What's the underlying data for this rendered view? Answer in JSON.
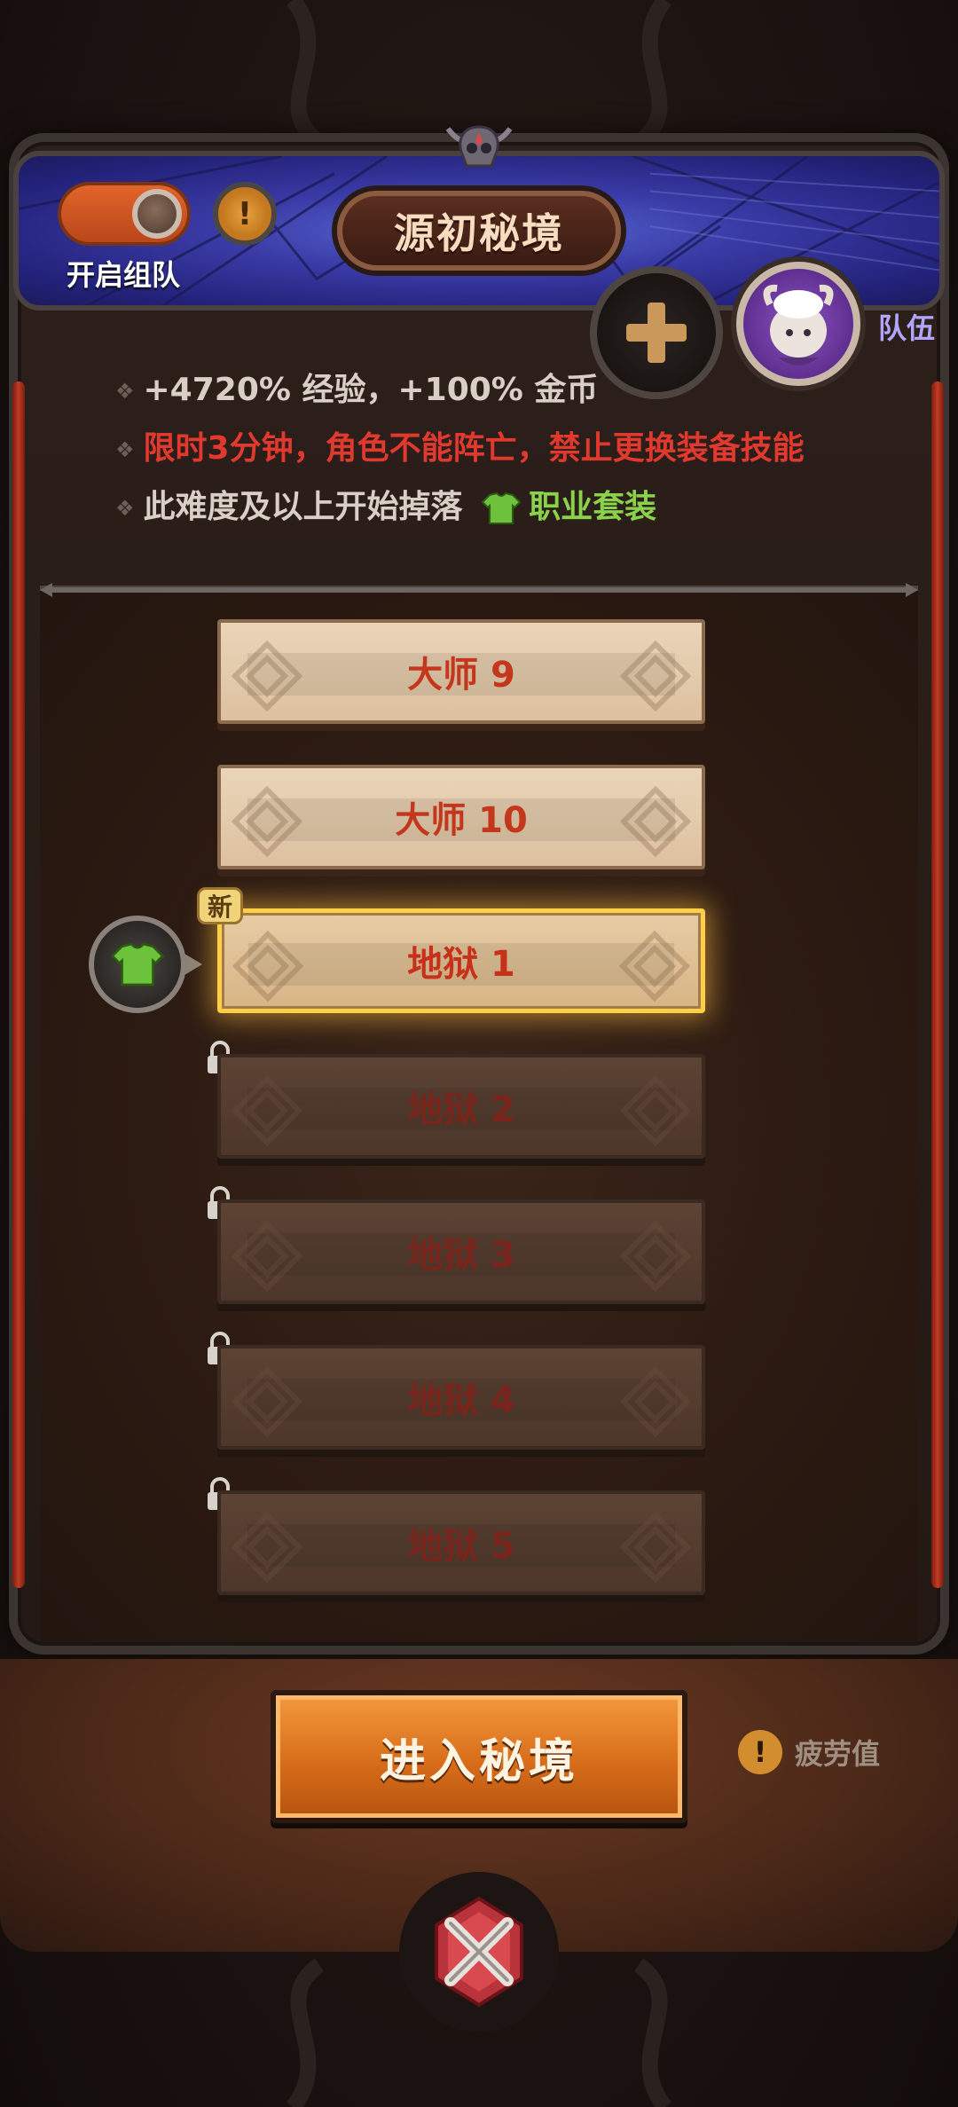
{
  "header": {
    "title": "源初秘境",
    "team_toggle_label": "开启组队",
    "team_toggle_on": true,
    "info_icon": "!",
    "team_label": "队伍"
  },
  "info": {
    "line1": "+4720% 经验，+100% 金币",
    "line2": "限时3分钟，角色不能阵亡，禁止更换装备技能",
    "line3_prefix": "此难度及以上开始掉落",
    "line3_highlight": "职业套装"
  },
  "difficulties": [
    {
      "label": "大师 9",
      "state": "unlocked"
    },
    {
      "label": "大师 10",
      "state": "unlocked"
    },
    {
      "label": "地狱 1",
      "state": "selected"
    },
    {
      "label": "地狱 2",
      "state": "locked"
    },
    {
      "label": "地狱 3",
      "state": "locked"
    },
    {
      "label": "地狱 4",
      "state": "locked"
    },
    {
      "label": "地狱 5",
      "state": "locked"
    }
  ],
  "new_badge": "新",
  "enter_button": "进入秘境",
  "fatigue": {
    "icon": "!",
    "label": "疲劳值"
  },
  "colors": {
    "accent_orange": "#d86d1a",
    "danger_red": "#e2392e",
    "set_green": "#8ad24a",
    "selected_gold": "#ffcf4a"
  },
  "icons": [
    "add-icon",
    "avatar-icon",
    "skull-icon",
    "lock-icon",
    "armor-icon",
    "close-icon"
  ]
}
